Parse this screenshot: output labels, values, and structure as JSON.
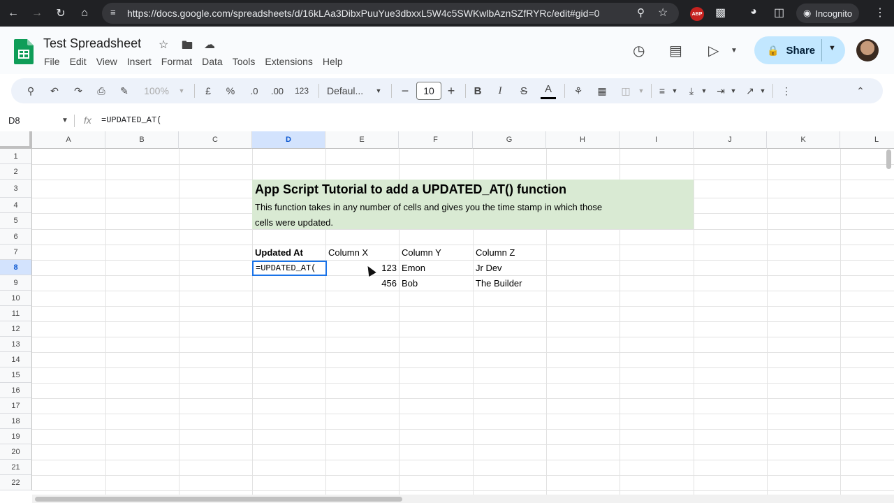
{
  "browser": {
    "url": "https://docs.google.com/spreadsheets/d/16kLAa3DibxPuuYue3dbxxL5W4c5SWKwlbAznSZfRYRc/edit#gid=0",
    "incognito_label": "Incognito",
    "extension_label": "ABP"
  },
  "doc": {
    "title": "Test Spreadsheet",
    "menu": [
      "File",
      "Edit",
      "View",
      "Insert",
      "Format",
      "Data",
      "Tools",
      "Extensions",
      "Help"
    ],
    "share_label": "Share"
  },
  "toolbar": {
    "zoom": "100%",
    "currency": "£",
    "percent": "%",
    "dec_decrease": ".0",
    "dec_increase": ".00",
    "number_format": "123",
    "font": "Defaul...",
    "font_size": "10",
    "bold": "B",
    "italic": "I",
    "strike": "S",
    "text_color": "A"
  },
  "formula_bar": {
    "name_box": "D8",
    "fx": "fx",
    "formula": "=UPDATED_AT("
  },
  "grid": {
    "columns": [
      "A",
      "B",
      "C",
      "D",
      "E",
      "F",
      "G",
      "H",
      "I",
      "J",
      "K",
      "L"
    ],
    "rows": [
      "1",
      "2",
      "3",
      "4",
      "5",
      "6",
      "7",
      "8",
      "9",
      "10",
      "11",
      "12",
      "13",
      "14",
      "15",
      "16",
      "17",
      "18",
      "19",
      "20",
      "21",
      "22"
    ],
    "active_column": "D",
    "active_row": "8",
    "banner_color": "#d9ead3",
    "banner_title": "App Script Tutorial to add a UPDATED_AT() function",
    "banner_desc_1": "This function takes in any number of cells and gives you the time stamp in which those",
    "banner_desc_2": "cells were updated.",
    "headers": {
      "d7": "Updated At",
      "e7": "Column X",
      "f7": "Column Y",
      "g7": "Column Z"
    },
    "row8": {
      "d": "=UPDATED_AT(",
      "e": "123",
      "f": "Emon",
      "g": "Jr Dev"
    },
    "row9": {
      "e": "456",
      "f": "Bob",
      "g": "The Builder"
    }
  }
}
